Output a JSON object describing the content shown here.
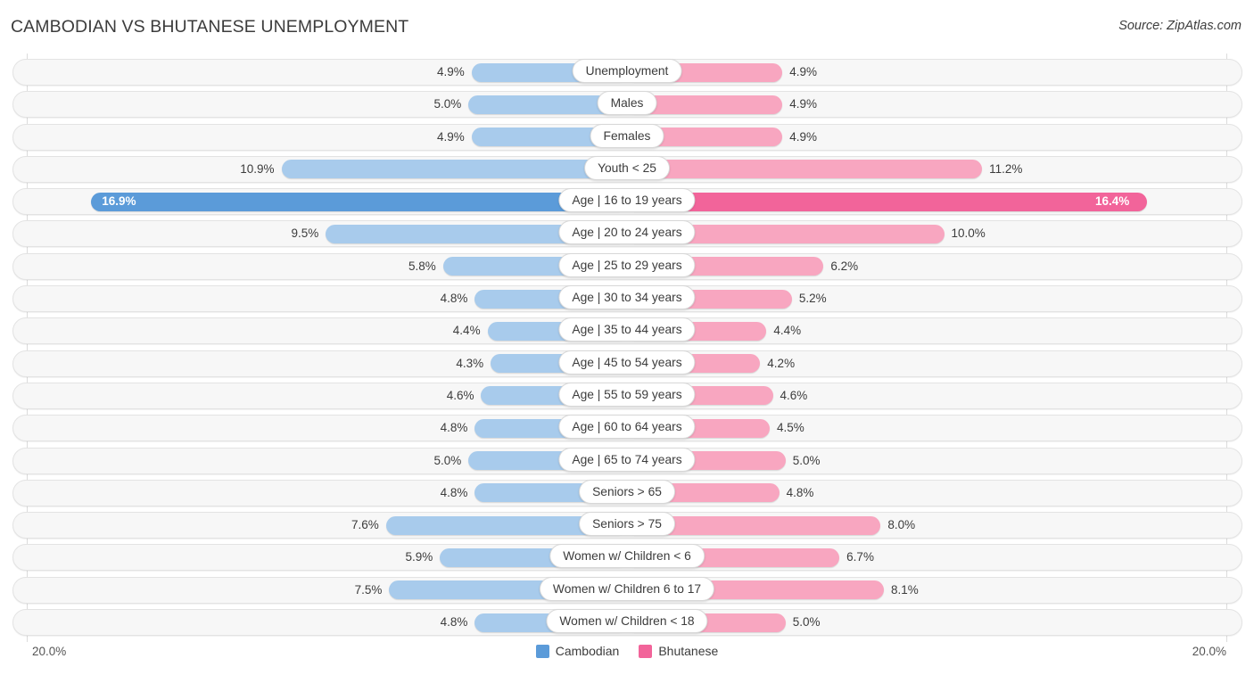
{
  "header": {
    "title": "CAMBODIAN VS BHUTANESE UNEMPLOYMENT",
    "source": "Source: ZipAtlas.com"
  },
  "axis": {
    "left_label": "20.0%",
    "right_label": "20.0%"
  },
  "legend": {
    "items": [
      {
        "label": "Cambodian",
        "color": "#5b9bd9"
      },
      {
        "label": "Bhutanese",
        "color": "#f2649a"
      }
    ]
  },
  "colors": {
    "left_normal": "#a8cbec",
    "left_highlight": "#5b9bd9",
    "right_normal": "#f8a6c0",
    "right_highlight": "#f2649a",
    "track": "#f7f7f7",
    "gridline": "#dcdcdc"
  },
  "chart_data": {
    "type": "bar",
    "title": "CAMBODIAN VS BHUTANESE UNEMPLOYMENT",
    "subtitle": "Source: ZipAtlas.com",
    "orientation": "horizontal-diverging",
    "xlabel": "",
    "ylabel": "",
    "xlim": [
      20.0,
      20.0
    ],
    "axis_left_max": "20.0%",
    "axis_right_max": "20.0%",
    "grid": true,
    "legend_position": "bottom-center",
    "categories": [
      "Unemployment",
      "Males",
      "Females",
      "Youth < 25",
      "Age | 16 to 19 years",
      "Age | 20 to 24 years",
      "Age | 25 to 29 years",
      "Age | 30 to 34 years",
      "Age | 35 to 44 years",
      "Age | 45 to 54 years",
      "Age | 55 to 59 years",
      "Age | 60 to 64 years",
      "Age | 65 to 74 years",
      "Seniors > 65",
      "Seniors > 75",
      "Women w/ Children < 6",
      "Women w/ Children 6 to 17",
      "Women w/ Children < 18"
    ],
    "series": [
      {
        "name": "Cambodian",
        "color": "#5b9bd9",
        "values": [
          4.9,
          5.0,
          4.9,
          10.9,
          16.9,
          9.5,
          5.8,
          4.8,
          4.4,
          4.3,
          4.6,
          4.8,
          5.0,
          4.8,
          7.6,
          5.9,
          7.5,
          4.8
        ],
        "labels": [
          "4.9%",
          "5.0%",
          "4.9%",
          "10.9%",
          "16.9%",
          "9.5%",
          "5.8%",
          "4.8%",
          "4.4%",
          "4.3%",
          "4.6%",
          "4.8%",
          "5.0%",
          "4.8%",
          "7.6%",
          "5.9%",
          "7.5%",
          "4.8%"
        ]
      },
      {
        "name": "Bhutanese",
        "color": "#f2649a",
        "values": [
          4.9,
          4.9,
          4.9,
          11.2,
          16.4,
          10.0,
          6.2,
          5.2,
          4.4,
          4.2,
          4.6,
          4.5,
          5.0,
          4.8,
          8.0,
          6.7,
          8.1,
          5.0
        ],
        "labels": [
          "4.9%",
          "4.9%",
          "4.9%",
          "11.2%",
          "16.4%",
          "10.0%",
          "6.2%",
          "5.2%",
          "4.4%",
          "4.2%",
          "4.6%",
          "4.5%",
          "5.0%",
          "4.8%",
          "8.0%",
          "6.7%",
          "8.1%",
          "5.0%"
        ]
      }
    ],
    "highlighted_row": "Age | 16 to 19 years"
  },
  "rows": [
    {
      "label": "Unemployment",
      "left_value": 4.9,
      "left_label": "4.9%",
      "right_value": 4.9,
      "right_label": "4.9%",
      "highlight": false
    },
    {
      "label": "Males",
      "left_value": 5.0,
      "left_label": "5.0%",
      "right_value": 4.9,
      "right_label": "4.9%",
      "highlight": false
    },
    {
      "label": "Females",
      "left_value": 4.9,
      "left_label": "4.9%",
      "right_value": 4.9,
      "right_label": "4.9%",
      "highlight": false
    },
    {
      "label": "Youth < 25",
      "left_value": 10.9,
      "left_label": "10.9%",
      "right_value": 11.2,
      "right_label": "11.2%",
      "highlight": false
    },
    {
      "label": "Age | 16 to 19 years",
      "left_value": 16.9,
      "left_label": "16.9%",
      "right_value": 16.4,
      "right_label": "16.4%",
      "highlight": true
    },
    {
      "label": "Age | 20 to 24 years",
      "left_value": 9.5,
      "left_label": "9.5%",
      "right_value": 10.0,
      "right_label": "10.0%",
      "highlight": false
    },
    {
      "label": "Age | 25 to 29 years",
      "left_value": 5.8,
      "left_label": "5.8%",
      "right_value": 6.2,
      "right_label": "6.2%",
      "highlight": false
    },
    {
      "label": "Age | 30 to 34 years",
      "left_value": 4.8,
      "left_label": "4.8%",
      "right_value": 5.2,
      "right_label": "5.2%",
      "highlight": false
    },
    {
      "label": "Age | 35 to 44 years",
      "left_value": 4.4,
      "left_label": "4.4%",
      "right_value": 4.4,
      "right_label": "4.4%",
      "highlight": false
    },
    {
      "label": "Age | 45 to 54 years",
      "left_value": 4.3,
      "left_label": "4.3%",
      "right_value": 4.2,
      "right_label": "4.2%",
      "highlight": false
    },
    {
      "label": "Age | 55 to 59 years",
      "left_value": 4.6,
      "left_label": "4.6%",
      "right_value": 4.6,
      "right_label": "4.6%",
      "highlight": false
    },
    {
      "label": "Age | 60 to 64 years",
      "left_value": 4.8,
      "left_label": "4.8%",
      "right_value": 4.5,
      "right_label": "4.5%",
      "highlight": false
    },
    {
      "label": "Age | 65 to 74 years",
      "left_value": 5.0,
      "left_label": "5.0%",
      "right_value": 5.0,
      "right_label": "5.0%",
      "highlight": false
    },
    {
      "label": "Seniors > 65",
      "left_value": 4.8,
      "left_label": "4.8%",
      "right_value": 4.8,
      "right_label": "4.8%",
      "highlight": false
    },
    {
      "label": "Seniors > 75",
      "left_value": 7.6,
      "left_label": "7.6%",
      "right_value": 8.0,
      "right_label": "8.0%",
      "highlight": false
    },
    {
      "label": "Women w/ Children < 6",
      "left_value": 5.9,
      "left_label": "5.9%",
      "right_value": 6.7,
      "right_label": "6.7%",
      "highlight": false
    },
    {
      "label": "Women w/ Children 6 to 17",
      "left_value": 7.5,
      "left_label": "7.5%",
      "right_value": 8.1,
      "right_label": "8.1%",
      "highlight": false
    },
    {
      "label": "Women w/ Children < 18",
      "left_value": 4.8,
      "left_label": "4.8%",
      "right_value": 5.0,
      "right_label": "5.0%",
      "highlight": false
    }
  ]
}
